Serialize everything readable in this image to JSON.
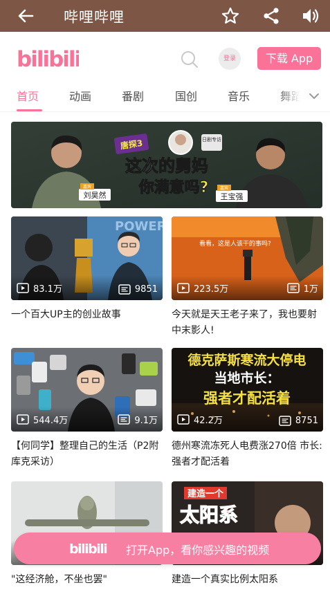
{
  "titlebar": {
    "title": "哔哩哔哩",
    "icons": [
      "back-arrow-icon",
      "star-icon",
      "share-icon",
      "volume-icon"
    ]
  },
  "header": {
    "logo": "bilibili",
    "login_label": "登录",
    "download_label": "下载 App",
    "accent_color": "#fb7299"
  },
  "tabs": [
    {
      "label": "首页",
      "active": true
    },
    {
      "label": "动画",
      "active": false
    },
    {
      "label": "番剧",
      "active": false
    },
    {
      "label": "国创",
      "active": false
    },
    {
      "label": "音乐",
      "active": false
    },
    {
      "label": "舞蹈",
      "active": false
    }
  ],
  "banner": {
    "headline_1": "这次的舅妈",
    "headline_2": "你满意吗?",
    "guest_label": "嘉宾",
    "guest_1": "刘昊然",
    "guest_2": "王宝强",
    "tag": "唐探3",
    "tag_2": "日剧专访"
  },
  "videos": [
    {
      "views": "83.1万",
      "danmaku": "9851",
      "title": "一个百大UP主的创业故事",
      "thumb_text": "POWER"
    },
    {
      "views": "223.5万",
      "danmaku": "1万",
      "title": "今天就是天王老子来了，我也要射中末影人!",
      "thumb_text": "看看，这是人该干的事吗?"
    },
    {
      "views": "544.4万",
      "danmaku": "9.1万",
      "title": "【何同学】整理自己的生活（P2附库克采访）",
      "thumb_text": ""
    },
    {
      "views": "42.2万",
      "danmaku": "8751",
      "title": "德州寒流冻死人电费涨270倍 市长:强者才配活着",
      "thumb_text_1": "德克萨斯寒流大停电",
      "thumb_text_2": "当地市长：",
      "thumb_text_3": "强者才配活着"
    },
    {
      "views": "",
      "danmaku": "",
      "title": "\"这经济舱，不坐也罢\"",
      "thumb_text": ""
    },
    {
      "views": "",
      "danmaku": "",
      "title": "建造一个真实比例太阳系",
      "thumb_text_1": "建造一个",
      "thumb_text_2": "太阳系"
    }
  ],
  "open_app": {
    "logo": "bilibili",
    "label": "打开App，看你感兴趣的视频"
  }
}
